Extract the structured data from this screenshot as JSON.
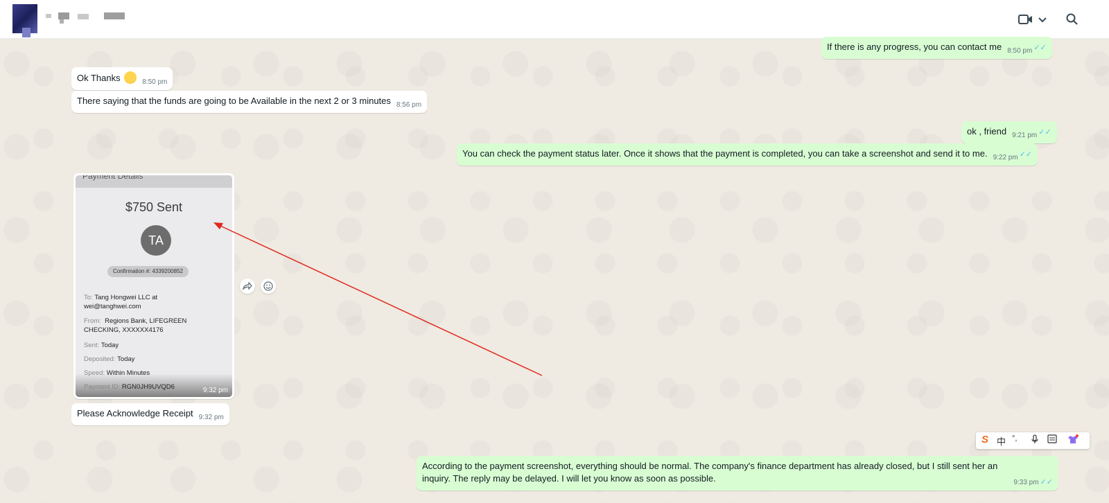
{
  "header": {
    "video_call_icon": "video-camera-icon",
    "dropdown_icon": "chevron-down-icon",
    "search_icon": "search-icon"
  },
  "messages": [
    {
      "side": "out",
      "text": "If there is any progress, you can contact me",
      "time": "8:50 pm",
      "status": "read"
    },
    {
      "side": "in",
      "text": "Ok Thanks",
      "time": "8:50 pm",
      "emoji": "smiling-face"
    },
    {
      "side": "in",
      "text": "There saying that the funds are going to be Available in the next 2 or 3 minutes",
      "time": "8:56 pm"
    },
    {
      "side": "out",
      "text": "ok , friend",
      "time": "9:21 pm",
      "status": "read"
    },
    {
      "side": "out",
      "text": "You can check the payment status later. Once it shows that the payment is completed, you can take a screenshot and send it to me.",
      "time": "9:22 pm",
      "status": "read"
    },
    {
      "side": "in",
      "type": "image",
      "time": "9:32 pm"
    },
    {
      "side": "in",
      "text": "Please Acknowledge Receipt",
      "time": "9:32 pm"
    },
    {
      "side": "out",
      "text_line1": "According to the payment screenshot, everything should be normal. The company's finance department has already closed, but I still sent her an",
      "text_line2": "inquiry. The reply may be delayed. I will let you know as soon as possible.",
      "time": "9:33 pm",
      "status": "read"
    }
  ],
  "payment_card": {
    "header": "Payment Details",
    "amount": "$750 Sent",
    "initials": "TA",
    "confirmation": "Confirmation #: 4339200852",
    "to_label": "To:",
    "to_value_1": "Tang Hongwei LLC at",
    "to_value_2": "wei@tanghwei.com",
    "from_label": "From:",
    "from_value_1": "Regions Bank, LIFEGREEN",
    "from_value_2": "CHECKING, XXXXXX4176",
    "sent_label": "Sent:",
    "sent_value": "Today",
    "deposited_label": "Deposited:",
    "deposited_value": "Today",
    "speed_label": "Speed:",
    "speed_value": "Within Minutes",
    "payment_id_label": "Payment ID:",
    "payment_id_value": "RGN0JH9UVQD6"
  },
  "ime_toolbar": {
    "logo": "S",
    "lang": "中",
    "punct": "°,",
    "colors": {
      "logo": "#f26b1d"
    }
  },
  "colors": {
    "outgoing_bubble": "#d9fdd3",
    "incoming_bubble": "#ffffff",
    "chat_background": "#efeae2",
    "read_ticks": "#53bdeb",
    "annotation_arrow": "#e0281e"
  }
}
